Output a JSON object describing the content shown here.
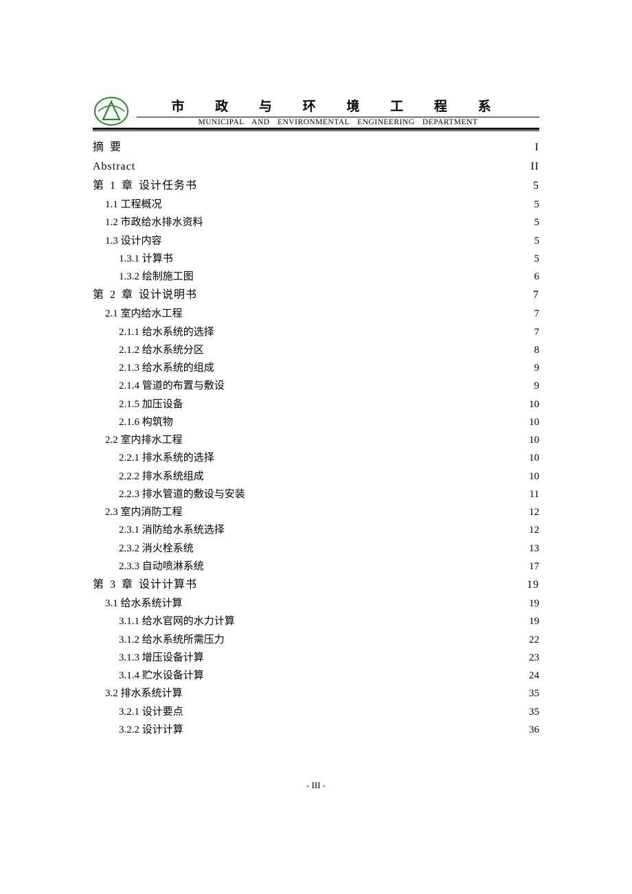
{
  "header": {
    "cn_title": "市 政 与 环 境 工 程 系",
    "en_title": "MUNICIPAL  AND  ENVIRONMENTAL  ENGINEERING  DEPARTMENT"
  },
  "toc": [
    {
      "level": "ch",
      "label": "摘  要",
      "page": "I"
    },
    {
      "level": "ch",
      "label": "Abstract",
      "page": "II"
    },
    {
      "level": "ch",
      "label": "第 1 章   设计任务书",
      "page": "5"
    },
    {
      "level": "1",
      "label": "1.1  工程概况",
      "page": "5"
    },
    {
      "level": "1",
      "label": "1.2  市政给水排水资料",
      "page": "5"
    },
    {
      "level": "1",
      "label": "1.3  设计内容",
      "page": "5"
    },
    {
      "level": "2",
      "label": "1.3.1  计算书",
      "page": "5"
    },
    {
      "level": "2",
      "label": "1.3.2  绘制施工图",
      "page": "6"
    },
    {
      "level": "ch",
      "label": "第 2 章  设计说明书",
      "page": "7"
    },
    {
      "level": "1",
      "label": "2.1  室内给水工程",
      "page": "7"
    },
    {
      "level": "2",
      "label": "2.1.1  给水系统的选择",
      "page": "7"
    },
    {
      "level": "2",
      "label": "2.1.2  给水系统分区",
      "page": "8"
    },
    {
      "level": "2",
      "label": "2.1.3  给水系统的组成",
      "page": "9"
    },
    {
      "level": "2",
      "label": "2.1.4  管道的布置与敷设",
      "page": "9"
    },
    {
      "level": "2",
      "label": "2.1.5  加压设备",
      "page": "10"
    },
    {
      "level": "2",
      "label": "2.1.6  构筑物",
      "page": "10"
    },
    {
      "level": "1",
      "label": "2.2  室内排水工程",
      "page": "10"
    },
    {
      "level": "2",
      "label": "2.2.1  排水系统的选择",
      "page": "10"
    },
    {
      "level": "2",
      "label": "2.2.2  排水系统组成",
      "page": "10"
    },
    {
      "level": "2",
      "label": "2.2.3  排水管道的敷设与安装",
      "page": "11"
    },
    {
      "level": "1",
      "label": "2.3  室内消防工程",
      "page": "12"
    },
    {
      "level": "2",
      "label": "2.3.1  消防给水系统选择",
      "page": "12"
    },
    {
      "level": "2",
      "label": "2.3.2  消火栓系统",
      "page": "13"
    },
    {
      "level": "2",
      "label": "2.3.3  自动喷淋系统",
      "page": "17"
    },
    {
      "level": "ch",
      "label": "第 3 章  设计计算书",
      "page": "19"
    },
    {
      "level": "1",
      "label": "3.1  给水系统计算",
      "page": "19"
    },
    {
      "level": "2",
      "label": "3.1.1  给水官网的水力计算",
      "page": "19"
    },
    {
      "level": "2",
      "label": "3.1.2  给水系统所需压力",
      "page": "22"
    },
    {
      "level": "2",
      "label": "3.1.3  增压设备计算",
      "page": "23"
    },
    {
      "level": "2",
      "label": "3.1.4  贮水设备计算",
      "page": "24"
    },
    {
      "level": "1",
      "label": "3.2  排水系统计算",
      "page": "35"
    },
    {
      "level": "2",
      "label": "3.2.1  设计要点",
      "page": "35"
    },
    {
      "level": "2",
      "label": "3.2.2  设计计算",
      "page": "36"
    }
  ],
  "footer": "- III -"
}
